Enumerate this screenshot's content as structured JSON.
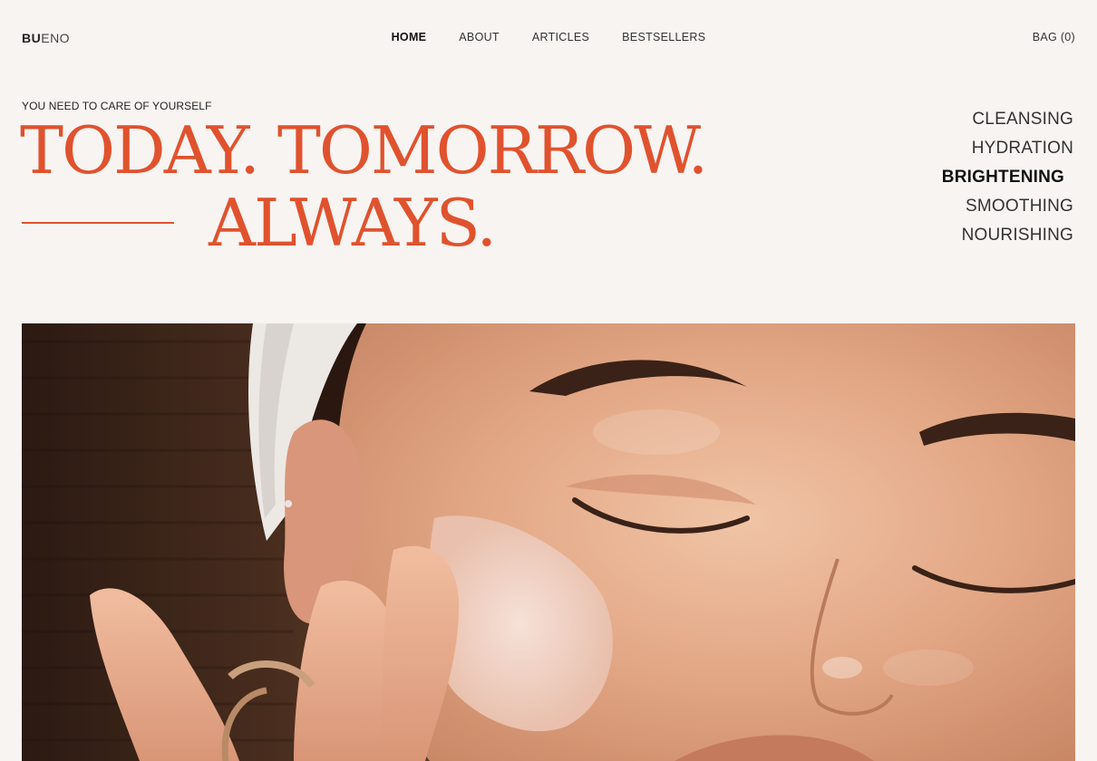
{
  "header": {
    "logo_bold": "BU",
    "logo_light": "ENO",
    "nav": [
      {
        "label": "HOME",
        "active": true
      },
      {
        "label": "ABOUT",
        "active": false
      },
      {
        "label": "ARTICLES",
        "active": false
      },
      {
        "label": "BESTSELLERS",
        "active": false
      }
    ],
    "bag_label": "BAG (0)"
  },
  "hero": {
    "tagline": "YOU NEED TO CARE OF YOURSELF",
    "headline_line1": "TODAY. TOMORROW.",
    "headline_line2": "ALWAYS.",
    "categories": [
      {
        "label": "CLEANSING",
        "active": false
      },
      {
        "label": "HYDRATION",
        "active": false
      },
      {
        "label": "BRIGHTENING",
        "active": true
      },
      {
        "label": "SMOOTHING",
        "active": false
      },
      {
        "label": "NOURISHING",
        "active": false
      }
    ]
  },
  "colors": {
    "background": "#f8f4f1",
    "accent": "#e0522e",
    "text": "#222222"
  }
}
